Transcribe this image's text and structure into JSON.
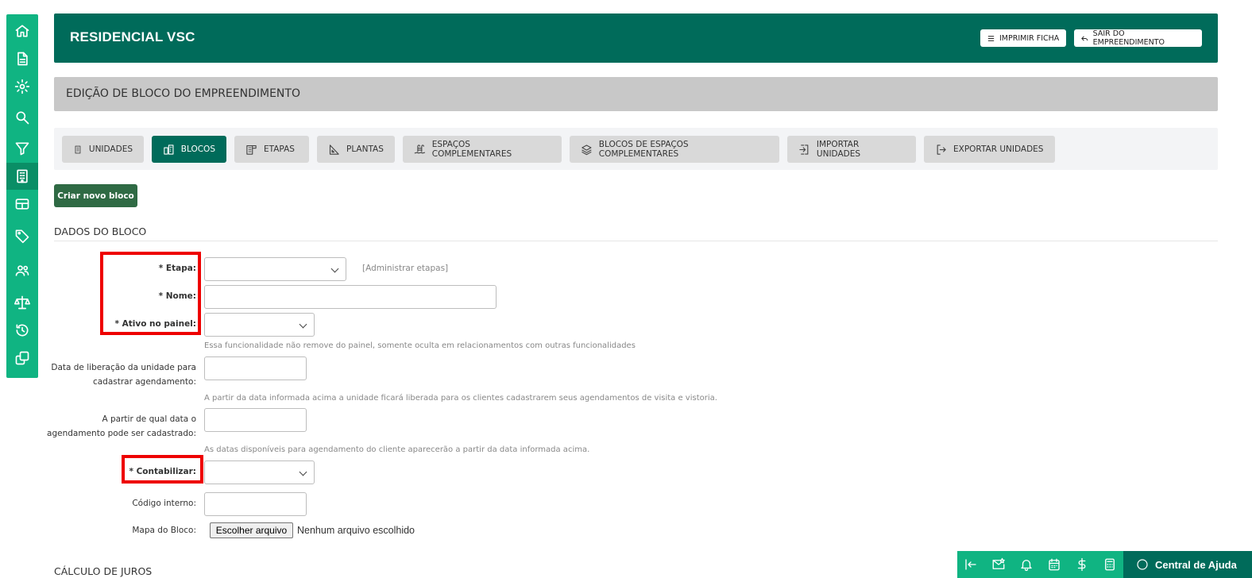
{
  "header": {
    "title": "RESIDENCIAL VSC",
    "print_label": "IMPRIMIR FICHA",
    "exit_label": "SAIR DO EMPREENDIMENTO"
  },
  "subheader": {
    "title": "EDIÇÃO DE BLOCO DO EMPREENDIMENTO"
  },
  "tabs": [
    {
      "label": "UNIDADES",
      "icon": "building-icon"
    },
    {
      "label": "BLOCOS",
      "icon": "blocks-icon",
      "active": true
    },
    {
      "label": "ETAPAS",
      "icon": "stage-icon"
    },
    {
      "label": "PLANTAS",
      "icon": "ruler-icon"
    },
    {
      "label": "ESPAÇOS COMPLEMENTARES",
      "icon": "pool-icon"
    },
    {
      "label": "BLOCOS DE ESPAÇOS COMPLEMENTARES",
      "icon": "layers-icon"
    },
    {
      "label": "IMPORTAR UNIDADES",
      "icon": "import-icon"
    },
    {
      "label": "EXPORTAR UNIDADES",
      "icon": "export-icon"
    }
  ],
  "new_block_label": "Criar novo bloco",
  "section": {
    "title": "DADOS DO BLOCO",
    "next_title": "CÁLCULO DE JUROS"
  },
  "form": {
    "etapa_label": "* Etapa:",
    "etapa_value": "",
    "admin_link": "[Administrar etapas]",
    "nome_label": "* Nome:",
    "nome_value": "",
    "ativo_label": "* Ativo no painel:",
    "ativo_value": "",
    "ativo_help": "Essa funcionalidade não remove do painel, somente oculta em relacionamentos com outras funcionalidades",
    "liberacao_label_1": "Data de liberação da unidade para",
    "liberacao_label_2": "cadastrar agendamento:",
    "liberacao_value": "",
    "liberacao_help": "A partir da data informada acima a unidade ficará liberada para os clientes cadastrarem seus agendamentos de visita e vistoria.",
    "agendamento_label_1": "A partir de qual data o",
    "agendamento_label_2": "agendamento pode ser cadastrado:",
    "agendamento_value": "",
    "agendamento_help": "As datas disponíveis para agendamento do cliente aparecerão a partir da data informada acima.",
    "contabilizar_label": "* Contabilizar:",
    "contabilizar_value": "",
    "codigo_label": "Código interno:",
    "codigo_value": "",
    "mapa_label": "Mapa do Bloco:",
    "file_button": "Escolher arquivo",
    "file_status": "Nenhum arquivo escolhido"
  },
  "sidebar": {
    "items": [
      {
        "icon": "home-icon"
      },
      {
        "icon": "document-icon"
      },
      {
        "icon": "gear-icon"
      },
      {
        "icon": "search-icon"
      },
      {
        "icon": "filter-icon"
      },
      {
        "icon": "building-icon",
        "active": true
      },
      {
        "icon": "table-icon"
      },
      {
        "icon": "tag-icon"
      },
      {
        "icon": "users-icon"
      },
      {
        "icon": "scale-icon"
      },
      {
        "icon": "history-icon"
      },
      {
        "icon": "copy-icon"
      }
    ]
  },
  "bottom_bar": {
    "icons": [
      "collapse-icon",
      "mail-star-icon",
      "bell-icon",
      "calendar-icon",
      "dollar-icon",
      "calculator-icon"
    ],
    "help_label": "Central de Ajuda"
  },
  "colors": {
    "primary": "#006b5a",
    "accent": "#10b482",
    "highlight": "#ee0000",
    "subheader": "#c8c8c8"
  }
}
